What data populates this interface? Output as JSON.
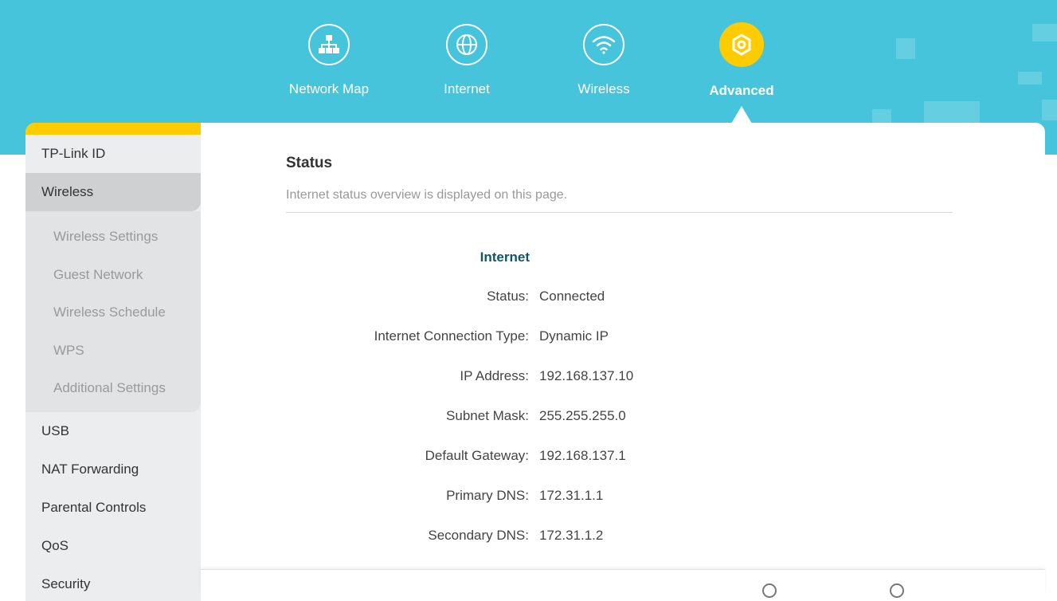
{
  "nav": {
    "items": [
      {
        "label": "Network Map",
        "icon": "network-map-icon"
      },
      {
        "label": "Internet",
        "icon": "globe-icon"
      },
      {
        "label": "Wireless",
        "icon": "wifi-icon"
      },
      {
        "label": "Advanced",
        "icon": "gear-icon",
        "active": true
      }
    ]
  },
  "sidebar": {
    "items": [
      {
        "label": "TP-Link ID"
      },
      {
        "label": "Wireless",
        "active": true
      },
      {
        "label": "USB"
      },
      {
        "label": "NAT Forwarding"
      },
      {
        "label": "Parental Controls"
      },
      {
        "label": "QoS"
      },
      {
        "label": "Security"
      }
    ],
    "wireless_sub": [
      {
        "label": "Wireless Settings"
      },
      {
        "label": "Guest Network"
      },
      {
        "label": "Wireless Schedule"
      },
      {
        "label": "WPS"
      },
      {
        "label": "Additional Settings"
      }
    ]
  },
  "main": {
    "title": "Status",
    "description": "Internet status overview is displayed on this page.",
    "group_title": "Internet",
    "rows": [
      {
        "label": "Status:",
        "value": "Connected"
      },
      {
        "label": "Internet Connection Type:",
        "value": "Dynamic IP"
      },
      {
        "label": "IP Address:",
        "value": "192.168.137.10"
      },
      {
        "label": "Subnet Mask:",
        "value": "255.255.255.0"
      },
      {
        "label": "Default Gateway:",
        "value": "192.168.137.1"
      },
      {
        "label": "Primary DNS:",
        "value": "172.31.1.1"
      },
      {
        "label": "Secondary DNS:",
        "value": "172.31.1.2"
      }
    ]
  },
  "colors": {
    "header_bg": "#45c4db",
    "accent": "#ffcc00",
    "group_title": "#115566"
  }
}
